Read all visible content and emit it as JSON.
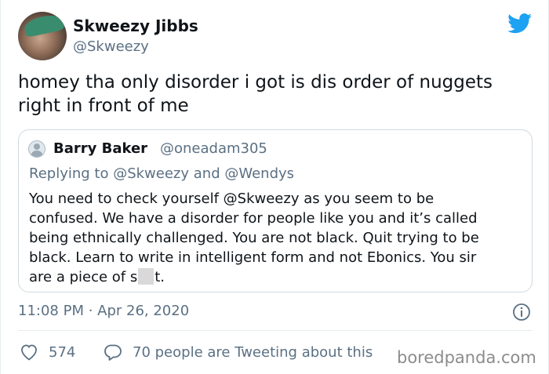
{
  "tweet": {
    "display_name": "Skweezy Jibbs",
    "handle": "@Skweezy",
    "text_lines": [
      "homey tha only disorder i got is dis order of nuggets",
      "right in front of me"
    ],
    "timestamp": "11:08 PM · Apr 26, 2020",
    "like_count": "574",
    "tweeting_about": "70 people are Tweeting about this"
  },
  "quote": {
    "display_name": "Barry Baker",
    "handle": "@oneadam305",
    "replying_prefix": "Replying to ",
    "replying_user1": "@Skweezy",
    "replying_and": " and ",
    "replying_user2": "@Wendys",
    "body_lines": [
      "You need to check yourself @Skweezy  as you seem to be",
      "confused. We have a disorder for people like you and it’s called",
      "being ethnically challenged. You are not black. Quit trying to be",
      "black. Learn to write in intelligent form and not Ebonics. You sir"
    ],
    "last_line_start": "are a piece of s",
    "last_line_end": "t."
  },
  "watermark": "boredpanda.com",
  "colors": {
    "brand_blue": "#1da1f2",
    "secondary_text": "#5b7083"
  },
  "icons": {
    "brand": "twitter-bird-icon",
    "info": "info-icon",
    "like": "heart-icon",
    "reply": "reply-bubble-icon"
  }
}
